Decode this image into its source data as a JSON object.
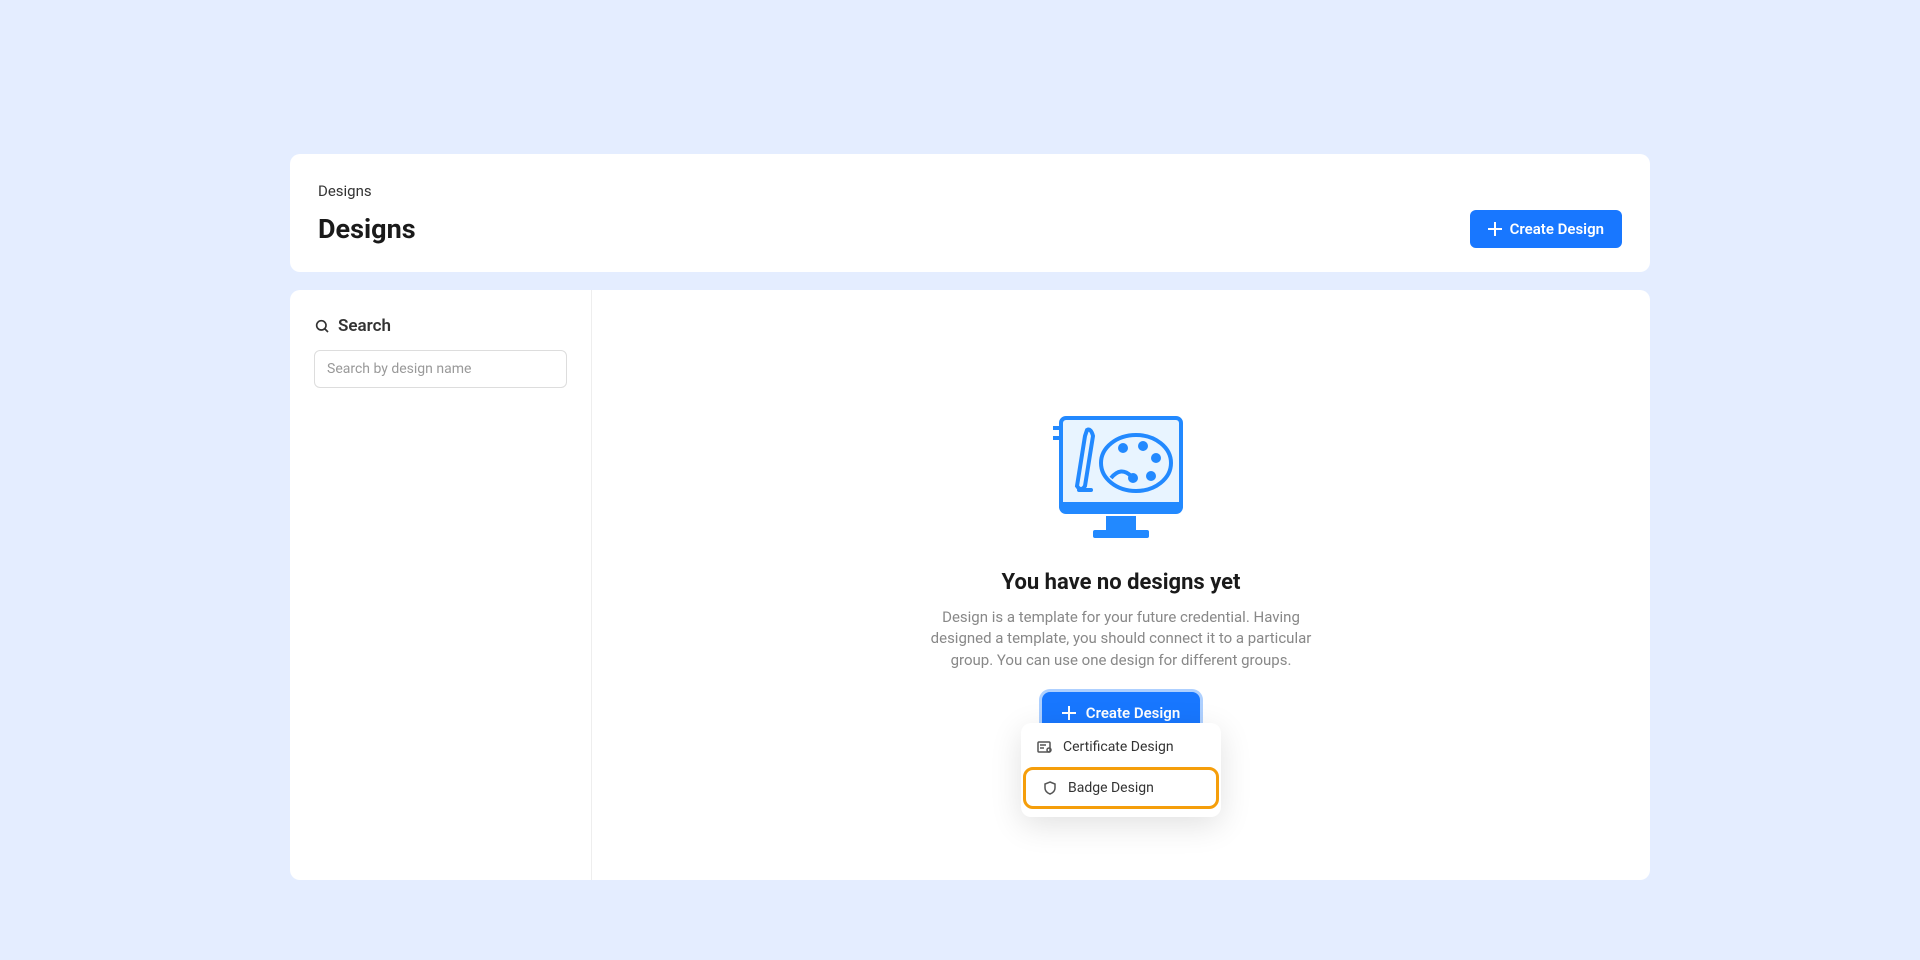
{
  "breadcrumb": "Designs",
  "page_title": "Designs",
  "header": {
    "create_button_label": "Create Design"
  },
  "sidebar": {
    "search_label": "Search",
    "search_placeholder": "Search by design name"
  },
  "empty_state": {
    "title": "You have no designs yet",
    "description": "Design is a template for your future credential. Having designed a template, you should connect it to a particular group. You can use one design for different groups.",
    "create_button_label": "Create Design"
  },
  "dropdown": {
    "items": [
      {
        "label": "Certificate Design",
        "highlighted": false
      },
      {
        "label": "Badge Design",
        "highlighted": true
      }
    ]
  },
  "colors": {
    "primary": "#1877ff",
    "highlight_border": "#f59e0b",
    "background": "#e4edff"
  }
}
